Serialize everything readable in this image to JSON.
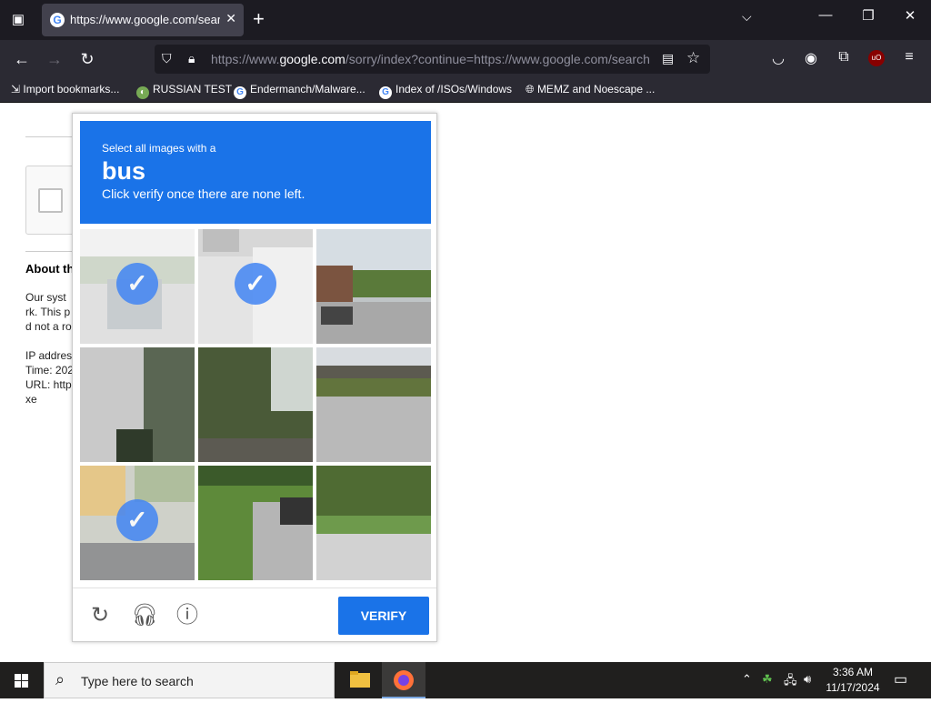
{
  "browser": {
    "tab": {
      "title": "https://www.google.com/search"
    },
    "url": {
      "prefix": "https://www.",
      "host": "google.com",
      "path": "/sorry/index?continue=https://www.google.com/search"
    },
    "bookmarks": [
      {
        "label": "Import bookmarks...",
        "icon": "import-icon"
      },
      {
        "label": "RUSSIAN TEST",
        "icon": "site-icon"
      },
      {
        "label": "Endermanch/Malware...",
        "icon": "google-icon"
      },
      {
        "label": "Index of /ISOs/Windows",
        "icon": "google-icon"
      },
      {
        "label": "MEMZ and Noescape ...",
        "icon": "globe-icon"
      }
    ],
    "extension_badge": "uO"
  },
  "page": {
    "about_heading": "About th",
    "lines": [
      "Our syst",
      "rk. This p",
      "d not a ro",
      "IP addres",
      "Time: 202",
      "URL: http",
      "xe"
    ]
  },
  "captcha": {
    "instruction_top": "Select all images with a",
    "target": "bus",
    "instruction_bottom": "Click verify once there are none left.",
    "tiles": [
      {
        "selected": true
      },
      {
        "selected": true
      },
      {
        "selected": false
      },
      {
        "selected": false
      },
      {
        "selected": false
      },
      {
        "selected": false
      },
      {
        "selected": true
      },
      {
        "selected": false
      },
      {
        "selected": false
      }
    ],
    "verify_label": "VERIFY"
  },
  "taskbar": {
    "search_placeholder": "Type here to search",
    "time": "3:36 AM",
    "date": "11/17/2024"
  }
}
